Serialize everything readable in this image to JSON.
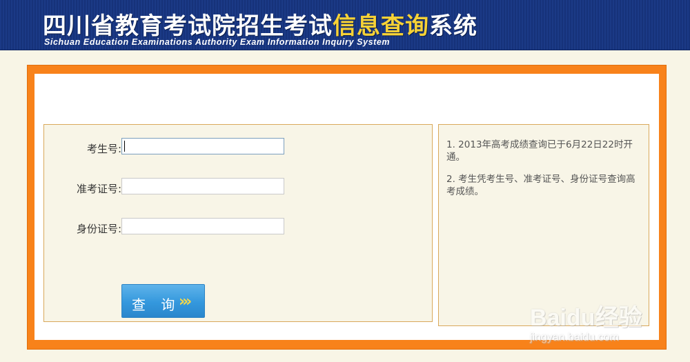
{
  "header": {
    "title_main": "四川省教育考试院招生考试",
    "title_highlight": "信息查询",
    "title_tail": "系统",
    "subtitle": "Sichuan Education Examinations Authority Exam Information Inquiry System"
  },
  "form": {
    "exam_no_label": "考生号:",
    "exam_no_value": "",
    "admission_no_label": "准考证号:",
    "admission_no_value": "",
    "id_no_label": "身份证号:",
    "id_no_value": "",
    "query_button_label": "查 询",
    "query_button_chevron": "»"
  },
  "notices": [
    "1. 2013年高考成绩查询已于6月22日22时开通。",
    "2. 考生凭考生号、准考证号、身份证号查询高考成绩。"
  ],
  "watermark": {
    "brand": "Baidu经验",
    "domain": "jingyan.baidu.com"
  },
  "colors": {
    "header_bg": "#1b3a86",
    "title_highlight": "#f7d236",
    "frame": "#f8821a",
    "button": "#3498dd"
  }
}
